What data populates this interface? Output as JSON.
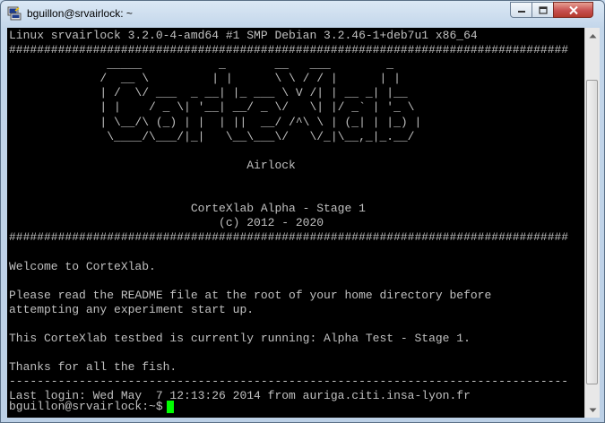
{
  "window": {
    "title": "bguillon@srvairlock: ~",
    "app_icon": "putty-icon",
    "controls": [
      "minimize-icon",
      "maximize-icon",
      "close-icon"
    ]
  },
  "terminal": {
    "lines": [
      "Linux srvairlock 3.2.0-4-amd64 #1 SMP Debian 3.2.46-1+deb7u1 x86_64",
      "################################################################################",
      "              _____           _       __   ___        _",
      "             /  __ \\         | |      \\ \\ / / |      | |",
      "             | /  \\/ ___  _ __| |_ ___ \\ V /| | __ _| |__",
      "             | |    / _ \\| '__| __/ _ \\/   \\| |/ _` | '_ \\",
      "             | \\__/\\ (_) | |  | ||  __/ /^\\ \\ | (_| | |_) |",
      "              \\____/\\___/|_|   \\__\\___\\/   \\/_|\\__,_|_.__/",
      "",
      "                                  Airlock",
      "",
      "",
      "                          CorteXlab Alpha - Stage 1",
      "                              (c) 2012 - 2020",
      "################################################################################",
      "",
      "Welcome to CorteXlab.",
      "",
      "Please read the README file at the root of your home directory before",
      "attempting any experiment start up.",
      "",
      "This CorteXlab testbed is currently running: Alpha Test - Stage 1.",
      "",
      "Thanks for all the fish.",
      "--------------------------------------------------------------------------------",
      "Last login: Wed May  7 12:13:26 2014 from auriga.citi.insa-lyon.fr"
    ],
    "prompt": "bguillon@srvairlock:~$",
    "cursor_color": "#00ff00",
    "text_color": "#c0c0c0",
    "background_color": "#000000"
  },
  "scrollbar": {
    "up_icon": "scroll-up-arrow-icon",
    "down_icon": "scroll-down-arrow-icon"
  }
}
